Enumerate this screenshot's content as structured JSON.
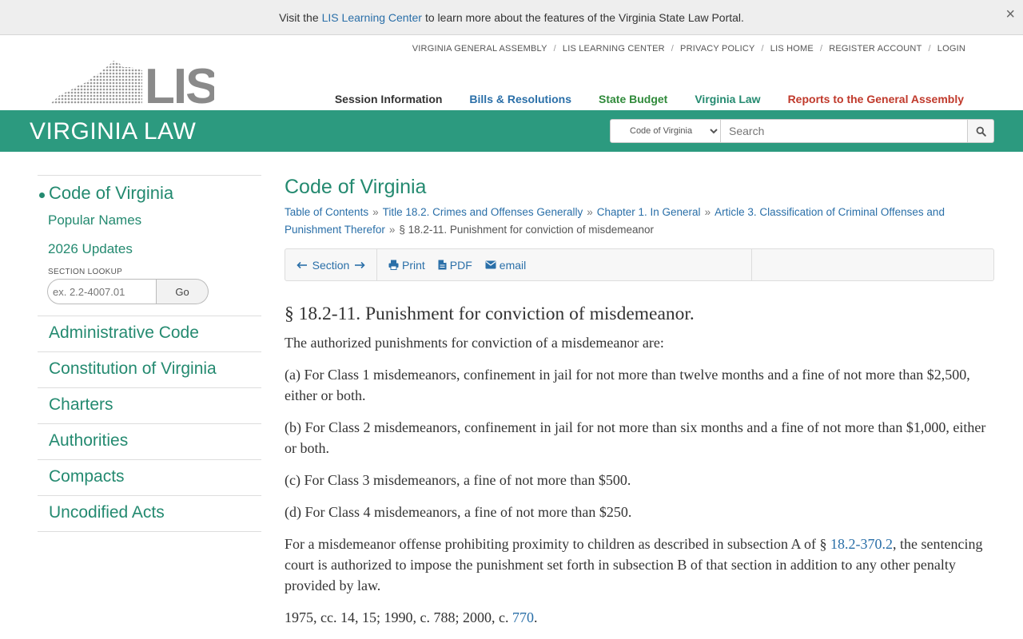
{
  "banner": {
    "before": "Visit the",
    "link": "LIS Learning Center",
    "after": "to learn more about the features of the Virginia State Law Portal.",
    "close": "×"
  },
  "top_links": [
    "VIRGINIA GENERAL ASSEMBLY",
    "LIS LEARNING CENTER",
    "PRIVACY POLICY",
    "LIS HOME",
    "REGISTER ACCOUNT",
    "LOGIN"
  ],
  "logo_text": "LIS",
  "main_nav": [
    {
      "label": "Session Information",
      "color": "#333333"
    },
    {
      "label": "Bills & Resolutions",
      "color": "#2a6fa8"
    },
    {
      "label": "State Budget",
      "color": "#2f8a3a"
    },
    {
      "label": "Virginia Law",
      "color": "#248a70"
    },
    {
      "label": "Reports to the General Assembly",
      "color": "#c0392b"
    }
  ],
  "green_bar": {
    "title": "VIRGINIA LAW",
    "select_value": "Code of Virginia",
    "search_placeholder": "Search"
  },
  "sidebar": {
    "current": "Code of Virginia",
    "sub_items": [
      "Popular Names",
      "2026 Updates"
    ],
    "lookup_label": "SECTION LOOKUP",
    "lookup_placeholder": "ex. 2.2-4007.01",
    "go_label": "Go",
    "items": [
      "Administrative Code",
      "Constitution of Virginia",
      "Charters",
      "Authorities",
      "Compacts",
      "Uncodified Acts"
    ]
  },
  "main": {
    "title": "Code of Virginia",
    "breadcrumbs": [
      "Table of Contents",
      "Title 18.2. Crimes and Offenses Generally",
      "Chapter 1. In General",
      "Article 3. Classification of Criminal Offenses and Punishment Therefor"
    ],
    "breadcrumb_current": "§ 18.2-11. Punishment for conviction of misdemeanor",
    "separator": "»",
    "toolbar": {
      "section": "Section",
      "print": "Print",
      "pdf": "PDF",
      "email": "email"
    },
    "section_title": "§ 18.2-11. Punishment for conviction of misdemeanor.",
    "intro": "The authorized punishments for conviction of a misdemeanor are:",
    "clauses": [
      "(a) For Class 1 misdemeanors, confinement in jail for not more than twelve months and a fine of not more than $2,500, either or both.",
      "(b) For Class 2 misdemeanors, confinement in jail for not more than six months and a fine of not more than $1,000, either or both.",
      "(c) For Class 3 misdemeanors, a fine of not more than $500.",
      "(d) For Class 4 misdemeanors, a fine of not more than $250."
    ],
    "proximity": {
      "before": "For a misdemeanor offense prohibiting proximity to children as described in subsection A of §",
      "link": "18.2-370.2",
      "after": ", the sentencing court is authorized to impose the punishment set forth in subsection B of that section in addition to any other penalty provided by law."
    },
    "history": {
      "before": "1975, cc. 14, 15; 1990, c. 788; 2000, c.",
      "link": "770",
      "after": "."
    }
  }
}
